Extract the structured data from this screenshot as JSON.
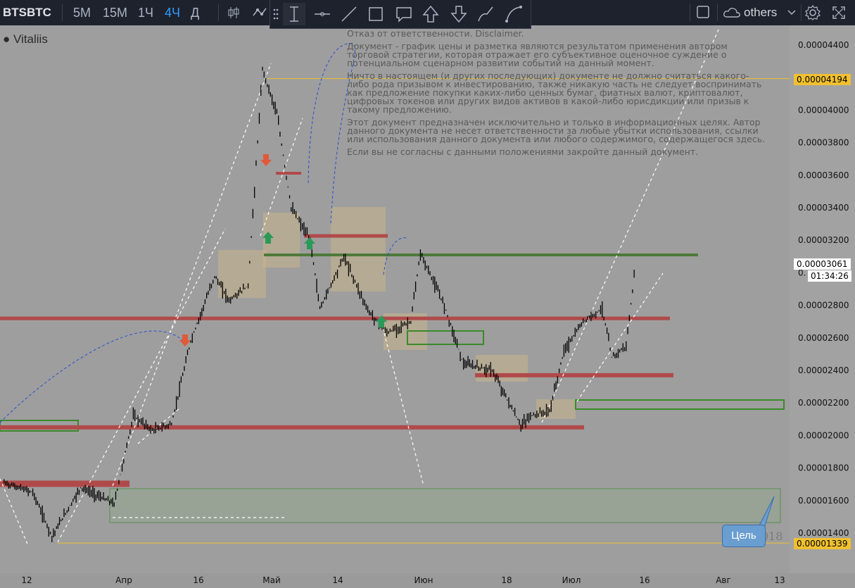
{
  "toolbar": {
    "symbol": "BTSBTC",
    "intervals": [
      "5M",
      "15M",
      "1Ч",
      "4Ч",
      "Д"
    ],
    "active_interval": "4Ч",
    "others_label": "others"
  },
  "user": "Vitaliis",
  "disclaimer": [
    "Отказ от ответственности. Disclaimer.",
    "Документ - график цены и разметка являются результатом применения автором торговой стратегии, которая отражает его субъективное оценочное суждение о потенциальном сценарном развитии событий на данный момент.",
    "Ничто в настоящем (и других последующих) документе не должно считаться какого-либо рода призывом к инвестированию, также никакую часть не следует воспринимать как предложение покупки каких-либо ценных бумаг, фиатных валют, криптовалют, цифровых токенов или других видов активов в какой-либо юрисдикции или призыв к такому предложению.",
    "Этот документ предназначен исключительно и только в информационных целях. Автор данного документа не несет ответственности за любые убытки использования, ссылки или использования данного документа или любого содержимого, содержащегося здесь.",
    "Если вы не согласны с данными положениями закройте данный документ."
  ],
  "price_tags": {
    "upper": "0.00004194",
    "current": "0.00003061",
    "countdown": "01:34:26",
    "lower": "0.00001339"
  },
  "target_label": "Цель",
  "watermark": "юн 2018",
  "chart_data": {
    "type": "candlestick",
    "symbol": "BTSBTC",
    "timeframe": "4Ч",
    "x_tick_labels": [
      "12",
      "Апр",
      "16",
      "Май",
      "14",
      "Июн",
      "18",
      "Июл",
      "16",
      "Авг",
      "13"
    ],
    "y_tick_labels": [
      "0.00004400",
      "0.00004000",
      "0.00003800",
      "0.00003600",
      "0.00003400",
      "0.00003200",
      "0.00002800",
      "0.00002600",
      "0.00002400",
      "0.00002200",
      "0.00002000",
      "0.00001800",
      "0.00001600",
      "0.00001400"
    ],
    "ylim": [
      1.28e-05,
      4.62e-05
    ],
    "price_path": [
      {
        "date": "Mar 08",
        "price": 1.71e-05
      },
      {
        "date": "Mar 14",
        "price": 1.65e-05
      },
      {
        "date": "Mar 18",
        "price": 1.38e-05
      },
      {
        "date": "Mar 24",
        "price": 1.68e-05
      },
      {
        "date": "Mar 31",
        "price": 1.58e-05
      },
      {
        "date": "Apr 04",
        "price": 2.12e-05
      },
      {
        "date": "Apr 08",
        "price": 2.03e-05
      },
      {
        "date": "Apr 12",
        "price": 2.07e-05
      },
      {
        "date": "Apr 16",
        "price": 2.58e-05
      },
      {
        "date": "Apr 21",
        "price": 2.98e-05
      },
      {
        "date": "Apr 24",
        "price": 2.83e-05
      },
      {
        "date": "Apr 28",
        "price": 2.92e-05
      },
      {
        "date": "May 01",
        "price": 4.25e-05
      },
      {
        "date": "May 04",
        "price": 3.98e-05
      },
      {
        "date": "May 07",
        "price": 3.4e-05
      },
      {
        "date": "May 11",
        "price": 3.2e-05
      },
      {
        "date": "May 13",
        "price": 2.78e-05
      },
      {
        "date": "May 18",
        "price": 3.1e-05
      },
      {
        "date": "May 23",
        "price": 2.77e-05
      },
      {
        "date": "May 27",
        "price": 2.63e-05
      },
      {
        "date": "Jun 01",
        "price": 2.7e-05
      },
      {
        "date": "Jun 03",
        "price": 3.12e-05
      },
      {
        "date": "Jun 08",
        "price": 2.8e-05
      },
      {
        "date": "Jun 12",
        "price": 2.44e-05
      },
      {
        "date": "Jun 18",
        "price": 2.4e-05
      },
      {
        "date": "Jun 24",
        "price": 2.06e-05
      },
      {
        "date": "Jun 26",
        "price": 2.12e-05
      },
      {
        "date": "Jun 30",
        "price": 2.15e-05
      },
      {
        "date": "Jul 03",
        "price": 2.52e-05
      },
      {
        "date": "Jul 07",
        "price": 2.7e-05
      },
      {
        "date": "Jul 11",
        "price": 2.78e-05
      },
      {
        "date": "Jul 13",
        "price": 2.48e-05
      },
      {
        "date": "Jul 16",
        "price": 2.55e-05
      },
      {
        "date": "Jul 18",
        "price": 3.06e-05
      }
    ],
    "horizontal_levels": [
      {
        "name": "upper-yellow-line",
        "price": 4.194e-05,
        "color": "#f0c030"
      },
      {
        "name": "lower-yellow-line",
        "price": 1.339e-05,
        "color": "#f0c030"
      },
      {
        "name": "green-line",
        "price": 3.11e-05,
        "color": "#4e7a3a"
      },
      {
        "name": "red-line-main",
        "price": 2.72e-05,
        "color": "#b04a4a"
      },
      {
        "name": "red-line-low",
        "price": 2.05e-05,
        "color": "#b04a4a"
      },
      {
        "name": "red-line-mid",
        "price": 2.37e-05,
        "color": "#b04a4a"
      }
    ],
    "colors": {
      "background": "#9e9e9e",
      "candles": "#000000",
      "red_level": "#b04a4a",
      "green_zone": "#3a8a2a",
      "price_label_bg": "#f0c030",
      "current_price_bg": "#ffffff",
      "projection": "#2a4fd0",
      "tool_blue": "#2e9cff"
    }
  }
}
